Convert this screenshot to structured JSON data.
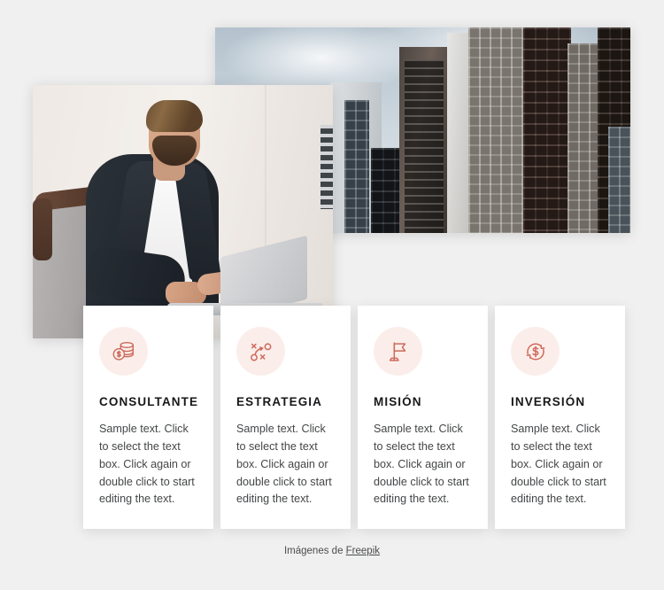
{
  "page": {
    "background_color": "#f0f0f0",
    "accent_color": "#cd6a5c",
    "icon_circle_color": "#fbeeea",
    "card_background": "#ffffff"
  },
  "media": {
    "city_photo": {
      "alt": "Modern city skyline with tall glass office buildings under an overcast sky"
    },
    "person_photo": {
      "alt": "Bearded businessman in a dark blazer and white t-shirt working on a laptop"
    }
  },
  "cards": [
    {
      "icon": "coins-stack-dollar-icon",
      "title": "CONSULTANTE",
      "body": "Sample text. Click to select the text box. Click again or double click to start editing the text."
    },
    {
      "icon": "strategy-tactics-icon",
      "title": "ESTRATEGIA",
      "body": "Sample text. Click to select the text box. Click again or double click to start editing the text."
    },
    {
      "icon": "flag-icon",
      "title": "MISIÓN",
      "body": "Sample text. Click to select the text box. Click again or double click to start editing the text."
    },
    {
      "icon": "currency-exchange-dollar-icon",
      "title": "INVERSIÓN",
      "body": "Sample text. Click to select the text box. Click again or double click to start editing the text."
    }
  ],
  "footer": {
    "prefix": "Imágenes de ",
    "link_label": "Freepik"
  }
}
